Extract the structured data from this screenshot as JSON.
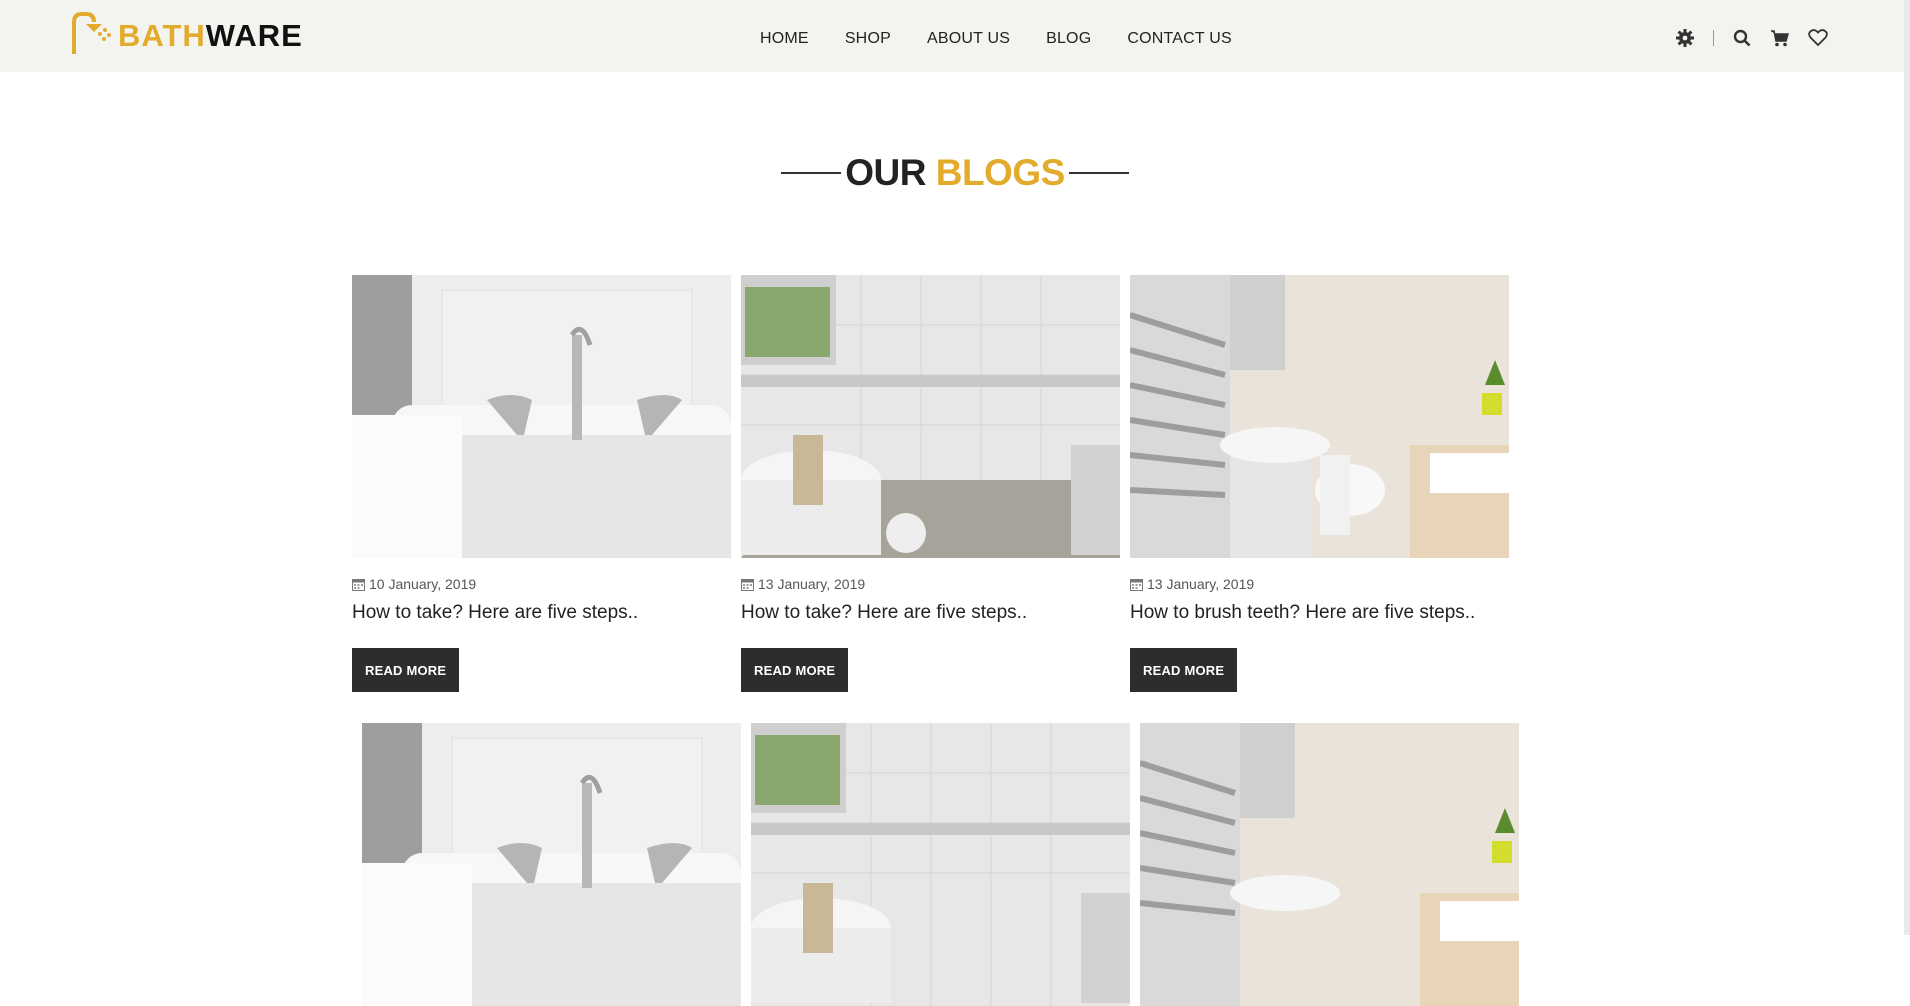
{
  "brand": {
    "part1": "BATH",
    "part2": "WARE"
  },
  "nav": {
    "items": [
      "HOME",
      "SHOP",
      "ABOUT US",
      "BLOG",
      "CONTACT US"
    ]
  },
  "tools": {
    "icons": [
      "gear-icon",
      "search-icon",
      "cart-icon",
      "heart-icon"
    ]
  },
  "section": {
    "title_part1": "OUR",
    "title_part2": "BLOGS"
  },
  "posts": [
    {
      "date": "10 January, 2019",
      "title": "How to take? Here are five steps..",
      "button": "READ MORE",
      "image": "bathtub-faucet"
    },
    {
      "date": "13 January, 2019",
      "title": "How to take? Here are five steps..",
      "button": "READ MORE",
      "image": "bathroom-tub-window"
    },
    {
      "date": "13 January, 2019",
      "title": "How to brush teeth? Here are five steps..",
      "button": "READ MORE",
      "image": "bathroom-sink-toilet"
    }
  ],
  "colors": {
    "accent": "#e3ab2c",
    "header_bg": "#f3f3ef",
    "button_bg": "#2d2d2d"
  }
}
